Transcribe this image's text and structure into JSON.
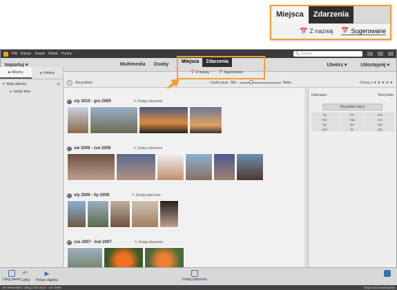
{
  "callout": {
    "tab_places": "Miejsca",
    "tab_events": "Zdarzenia",
    "by_name": "Z nazwą",
    "suggested": "Sugerowane"
  },
  "titlebar": {
    "menu": [
      "Plik",
      "Edycja",
      "Znajdź",
      "Widok",
      "Pomoc"
    ],
    "search_placeholder": "Szukaj"
  },
  "menubar": {
    "imports": "Importuj",
    "modes": [
      "Multimedia",
      "Osoby"
    ],
    "places": "Miejsca",
    "events": "Zdarzenia",
    "sub_by_name": "Z nazwą",
    "sub_suggested": "Sugerowane",
    "create": "Utwórz",
    "share": "Udostępnij"
  },
  "subbar": {
    "back": "‹",
    "all": "Wszystkich",
    "group_count": "Liczba grup:",
    "min": "Min.",
    "max": "Maks.",
    "rating": "Oceny ≥ ★ ★ ★ ★ ★"
  },
  "left": {
    "tab_albums": "Albumy",
    "tab_folders": "Foldery",
    "my_albums": "Moje albumy",
    "album1": "family time",
    "add": "+"
  },
  "events": [
    {
      "date": "sty 2010 - gru 2009",
      "edit": "Dodaj zdarzenie"
    },
    {
      "date": "sie 2009 - cze 2009",
      "edit": "Dodaj zdarzenie"
    },
    {
      "date": "sty 2009 - lip 2008",
      "edit": "Dodaj zdarzenie"
    },
    {
      "date": "cze 2007 - kwi 2007",
      "edit": "Dodaj zdarzenie"
    }
  ],
  "right": {
    "calendar": "Kalendarz",
    "all_label": "Wszystkie",
    "all_years": "Wszystkie lata ▾",
    "months": [
      [
        "sty",
        "lut",
        "mar"
      ],
      [
        "kwi",
        "maj",
        "cze"
      ],
      [
        "lip",
        "sie",
        "wrz"
      ],
      [
        "paź",
        "lis",
        "gru"
      ]
    ]
  },
  "bottom": {
    "panel": "Ukryj panel",
    "undo": "Cofnij",
    "slideshow": "Pokaz slajdów",
    "add_event": "Dodaj zdarzenie"
  },
  "status": {
    "left": "26 elementów | Ukryj | kwi 2010 - wrz 2006",
    "right": "Moja baza katalogowa"
  },
  "colors": {
    "accent": "#f0a030",
    "active_tab": "#2f2f2f"
  }
}
